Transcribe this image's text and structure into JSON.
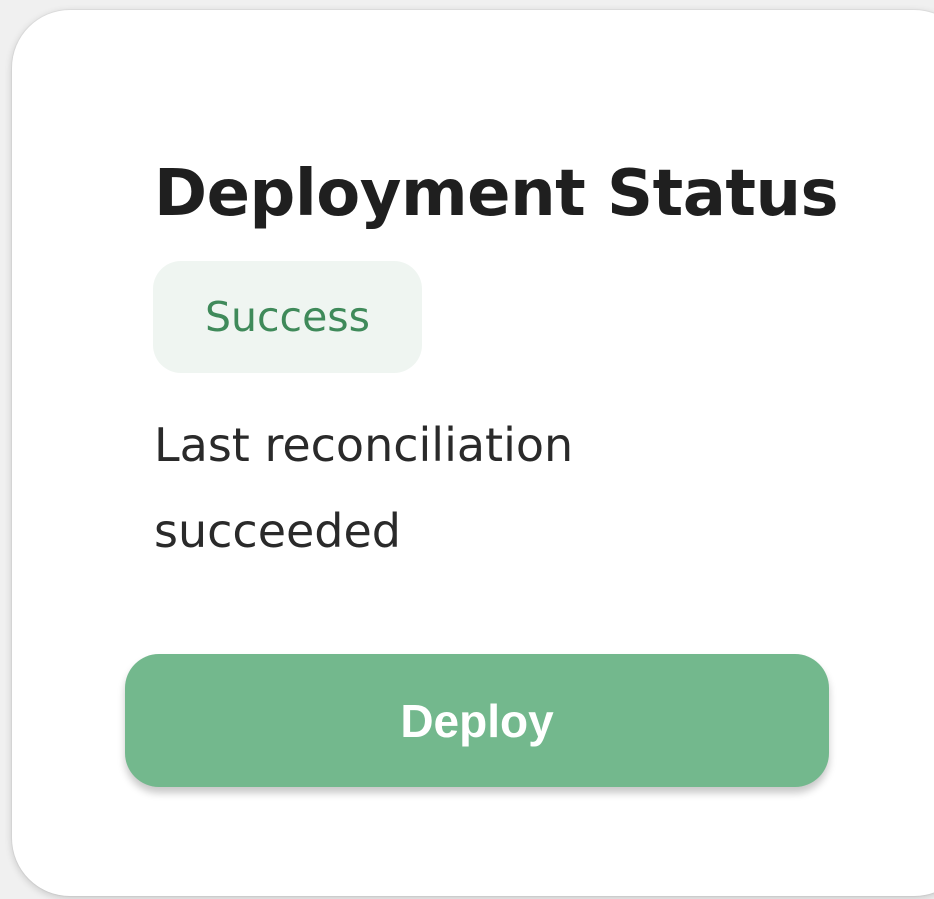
{
  "card": {
    "title": "Deployment Status",
    "status_badge": {
      "label": "Success",
      "colors": {
        "background": "#eff5f1",
        "text": "#3f8a5a"
      }
    },
    "message": "Last reconciliation succeeded",
    "deploy_button": {
      "label": "Deploy",
      "color": "#73b88d"
    }
  }
}
